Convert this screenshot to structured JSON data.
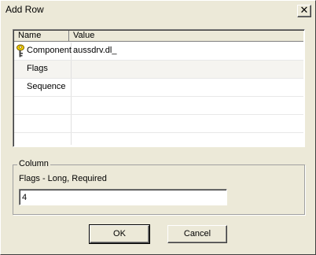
{
  "window": {
    "title": "Add Row"
  },
  "grid": {
    "columns": {
      "name": "Name",
      "value": "Value"
    },
    "rows": [
      {
        "name": "Component",
        "value": "aussdrv.dl_",
        "icon": "key-icon"
      },
      {
        "name": "Flags",
        "value": ""
      },
      {
        "name": "Sequence",
        "value": ""
      }
    ]
  },
  "column_group": {
    "legend": "Column",
    "description": "Flags - Long, Required",
    "input_value": "4"
  },
  "buttons": {
    "ok": "OK",
    "cancel": "Cancel"
  }
}
